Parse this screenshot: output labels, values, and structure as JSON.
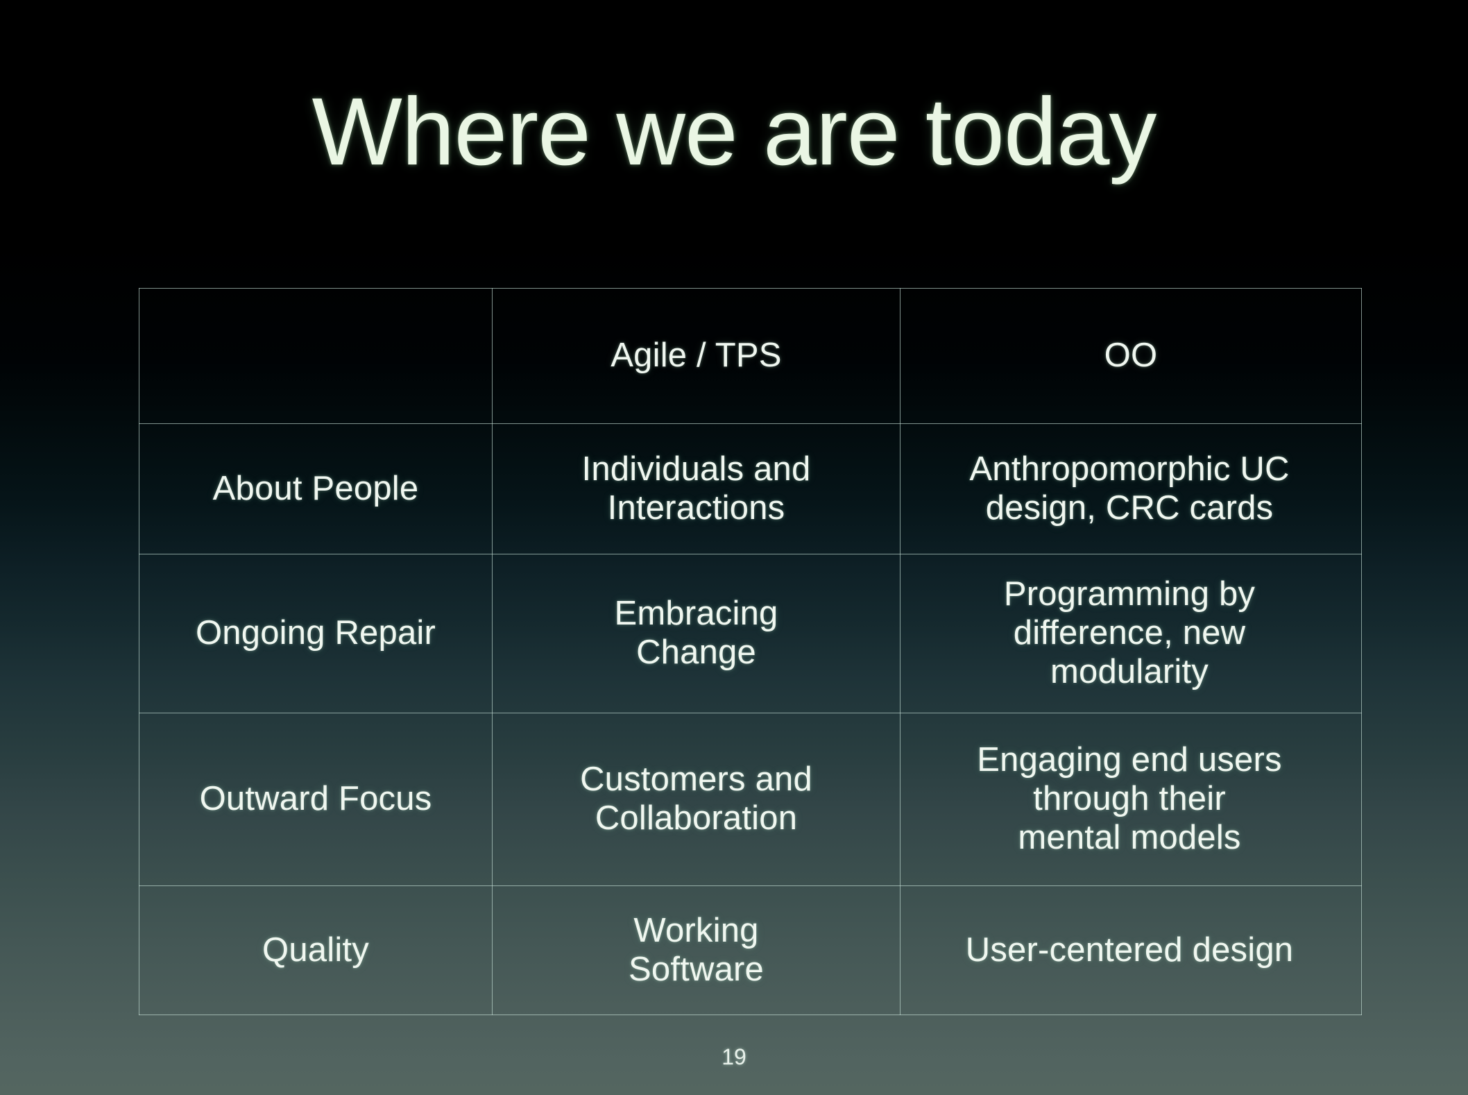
{
  "slide": {
    "title": "Where we are today",
    "page_number": "19",
    "colors": {
      "background_top": "#000000",
      "background_bottom": "#546660",
      "text": "#f0f7f0",
      "title_text": "#eaf6e4",
      "border": "#c4ded6"
    }
  },
  "table": {
    "columns": [
      {
        "key": "label",
        "header": ""
      },
      {
        "key": "agile",
        "header": "Agile / TPS"
      },
      {
        "key": "oo",
        "header": "OO"
      }
    ],
    "rows": [
      {
        "label": "About People",
        "agile": "Individuals and\nInteractions",
        "oo": "Anthropomorphic UC\ndesign, CRC cards"
      },
      {
        "label": "Ongoing Repair",
        "agile": "Embracing\nChange",
        "oo": "Programming by\ndifference, new\nmodularity"
      },
      {
        "label": "Outward Focus",
        "agile": "Customers and\nCollaboration",
        "oo": "Engaging end users\nthrough their\nmental models"
      },
      {
        "label": "Quality",
        "agile": "Working\nSoftware",
        "oo": "User-centered design"
      }
    ]
  }
}
